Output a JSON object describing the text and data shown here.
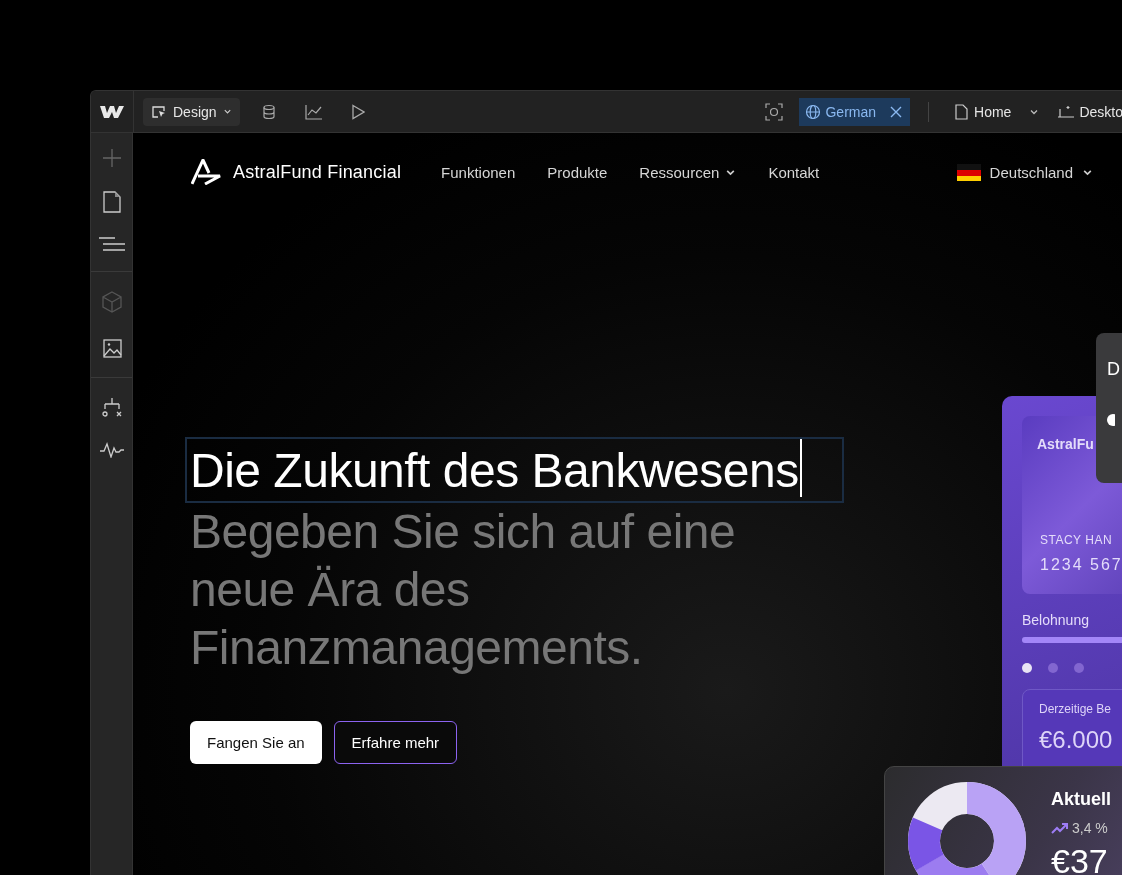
{
  "toolbar": {
    "mode_button": "Design",
    "locale_chip": {
      "label": "German",
      "selected": true
    },
    "page_menu": "Home",
    "breakpoint": "Deskto"
  },
  "left_rail": {
    "items": [
      {
        "kind": "add"
      },
      {
        "kind": "pages"
      },
      {
        "kind": "navigator"
      },
      {
        "kind": "components"
      },
      {
        "kind": "assets"
      },
      {
        "kind": "logic"
      },
      {
        "kind": "activity"
      }
    ]
  },
  "site_nav": {
    "brand": "AstralFund Financial",
    "links": [
      {
        "label": "Funktionen",
        "dropdown": false
      },
      {
        "label": "Produkte",
        "dropdown": false
      },
      {
        "label": "Ressourcen",
        "dropdown": true
      },
      {
        "label": "Kontakt",
        "dropdown": false
      }
    ],
    "region": "Deutschland"
  },
  "hero": {
    "heading": "Die Zukunft des Bankwesens",
    "heading_selected": true,
    "subheading": "Begeben Sie sich auf eine neue Ära des Finanzmanagements.",
    "buttons": [
      {
        "label": "Fangen Sie an",
        "kind": "primary"
      },
      {
        "label": "Erfahre mehr",
        "kind": "outline"
      }
    ]
  },
  "card_widget": {
    "card_brand": "AstralFu",
    "cardholder": "STACY HAN",
    "card_number": "1234 567",
    "reward_label": "Belohnung",
    "reward": {
      "level": 0.75
    },
    "dots": [
      {
        "selected": true
      },
      {
        "selected": false
      },
      {
        "selected": false
      }
    ],
    "balance_label": "Derzeitige Be",
    "balance": "€6.000"
  },
  "popup_panel": {
    "title": "D"
  },
  "portfolio_card": {
    "title": "Aktuell",
    "change": "3,4 %",
    "value": "€37"
  }
}
